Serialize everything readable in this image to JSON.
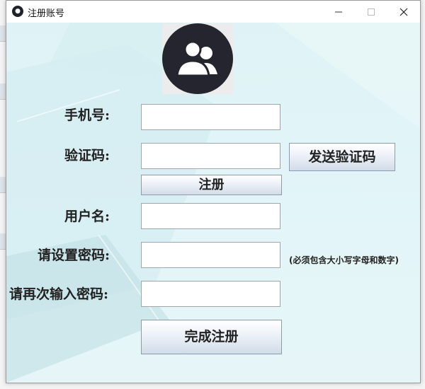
{
  "window": {
    "title": "注册账号",
    "icon": "user-app-icon"
  },
  "form": {
    "phone_label": "手机号:",
    "code_label": "验证码:",
    "send_code_button": "发送验证码",
    "register_button": "注册",
    "username_label": "用户名:",
    "password_label": "请设置密码:",
    "password_hint": "(必须包含大小写字母和数字)",
    "confirm_label": "请再次输入密码:",
    "finish_button": "完成注册",
    "phone_value": "",
    "code_value": "",
    "username_value": "",
    "password_value": "",
    "confirm_value": ""
  },
  "colors": {
    "background": "#e0f4f7",
    "avatar": "#25252f",
    "button_border": "#8d9bb0"
  }
}
